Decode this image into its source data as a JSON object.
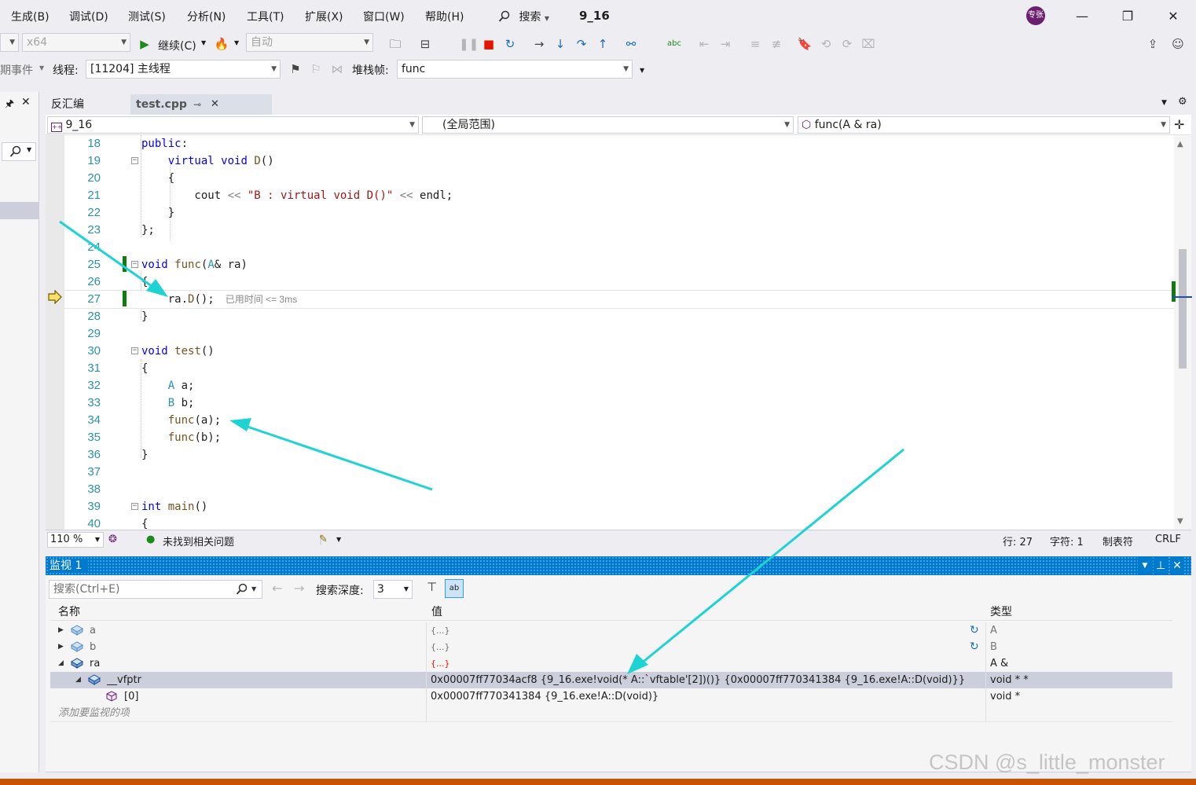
{
  "menu": [
    "生成(B)",
    "调试(D)",
    "测试(S)",
    "分析(N)",
    "工具(T)",
    "扩展(X)",
    "窗口(W)",
    "帮助(H)"
  ],
  "search_label": "搜索",
  "solution_name": "9_16",
  "avatar_text": "专张",
  "toolbar1": {
    "platform": "x64",
    "continue_label": "继续(C)",
    "auto_combo": "自动"
  },
  "toolbar2": {
    "lifecycle_events": "期事件",
    "thread_label": "线程:",
    "thread_value": "[11204] 主线程",
    "stack_label": "堆栈帧:",
    "stack_value": "func"
  },
  "tabs": {
    "disasm": "反汇编",
    "file": "test.cpp"
  },
  "navbar": {
    "project": "9_16",
    "scope": "(全局范围)",
    "member": "func(A & ra)"
  },
  "code": [
    {
      "n": "18"
    },
    {
      "n": "19"
    },
    {
      "n": "20"
    },
    {
      "n": "21"
    },
    {
      "n": "22"
    },
    {
      "n": "23"
    },
    {
      "n": "24"
    },
    {
      "n": "25"
    },
    {
      "n": "26"
    },
    {
      "n": "27"
    },
    {
      "n": "28"
    },
    {
      "n": "29"
    },
    {
      "n": "30"
    },
    {
      "n": "31"
    },
    {
      "n": "32"
    },
    {
      "n": "33"
    },
    {
      "n": "34"
    },
    {
      "n": "35"
    },
    {
      "n": "36"
    },
    {
      "n": "37"
    },
    {
      "n": "38"
    },
    {
      "n": "39"
    },
    {
      "n": "40"
    }
  ],
  "elapsed": "已用时间 <= 3ms",
  "editor_status": {
    "zoom": "110 %",
    "issues": "未找到相关问题",
    "line": "行: 27",
    "char": "字符: 1",
    "tabs": "制表符",
    "eol": "CRLF"
  },
  "watch": {
    "title": "监视 1",
    "search_placeholder": "搜索(Ctrl+E)",
    "depth_label": "搜索深度:",
    "depth_value": "3",
    "col_name": "名称",
    "col_value": "值",
    "col_type": "类型",
    "rows": [
      {
        "name": "a",
        "value": "{...}",
        "type": "A"
      },
      {
        "name": "b",
        "value": "{...}",
        "type": "B"
      },
      {
        "name": "ra",
        "value": "{...}",
        "type": "A &"
      },
      {
        "name": "__vfptr",
        "value": "0x00007ff77034acf8 {9_16.exe!void(* A::`vftable'[2])()} {0x00007ff770341384 {9_16.exe!A::D(void)}}",
        "type": "void * *"
      },
      {
        "name": "[0]",
        "value": "0x00007ff770341384 {9_16.exe!A::D(void)}",
        "type": "void *"
      }
    ],
    "add_item": "添加要监视的项"
  },
  "watermark": "CSDN @s_little_monster",
  "colors": {
    "accent": "#007acc",
    "status_orange": "#ca5100",
    "annotation_arrow": "#1ed3d3",
    "breakpoint_green": "#107c10"
  }
}
